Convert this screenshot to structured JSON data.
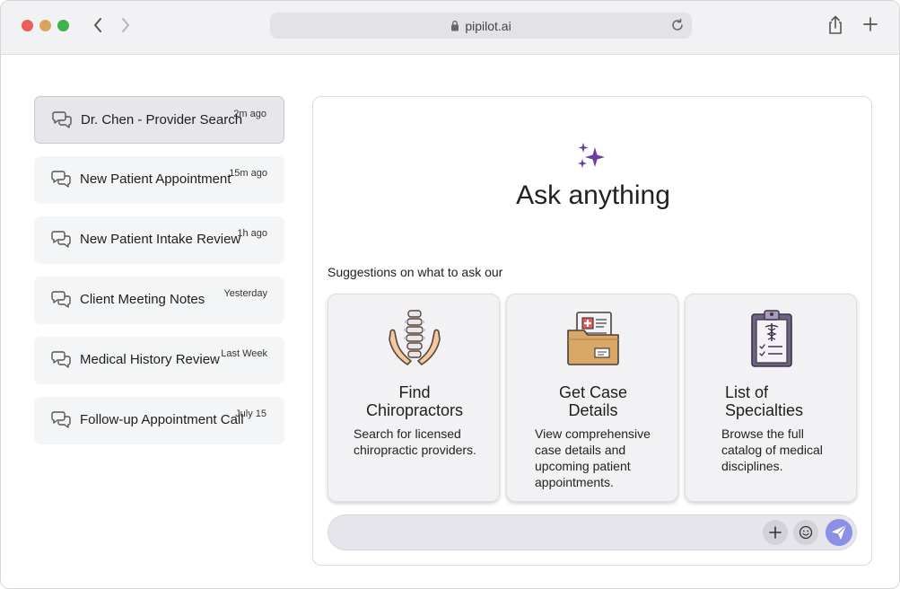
{
  "browser": {
    "url": "pipilot.ai",
    "icons": [
      "back-icon",
      "forward-icon",
      "lock-icon",
      "reload-icon",
      "share-icon",
      "new-tab-icon"
    ]
  },
  "sidebar": {
    "items": [
      {
        "label": "Dr. Chen - Provider Search",
        "time": "2m ago"
      },
      {
        "label": "New Patient Appointment",
        "time": "15m ago"
      },
      {
        "label": "New Patient Intake Review",
        "time": "1h ago"
      },
      {
        "label": "Client Meeting Notes",
        "time": "Yesterday"
      },
      {
        "label": "Medical History Review",
        "time": "Last Week"
      },
      {
        "label": "Follow-up Appointment Call",
        "time": "July 15"
      }
    ]
  },
  "main": {
    "title": "Ask anything",
    "suggestions_label": "Suggestions on what to ask our",
    "cards": [
      {
        "title_line1": "Find",
        "title_line2": "Chiropractors",
        "desc": [
          "Search for licensed",
          "chiropractic providers."
        ],
        "icon": "spine-hands-icon"
      },
      {
        "title_line1": "Get Case",
        "title_line2": "Details",
        "desc": [
          "View comprehensive",
          "case details and",
          "upcoming patient",
          "appointments."
        ],
        "icon": "medical-folder-icon"
      },
      {
        "title_line1": "List of",
        "title_line2": "Specialties",
        "desc": [
          "Browse the full",
          "catalog of medical",
          "disciplines."
        ],
        "icon": "clipboard-caduceus-icon"
      }
    ]
  },
  "composer": {
    "placeholder": ""
  },
  "colors": {
    "accent": "#8b8fe6",
    "sparkle": "#6b3fa0"
  }
}
